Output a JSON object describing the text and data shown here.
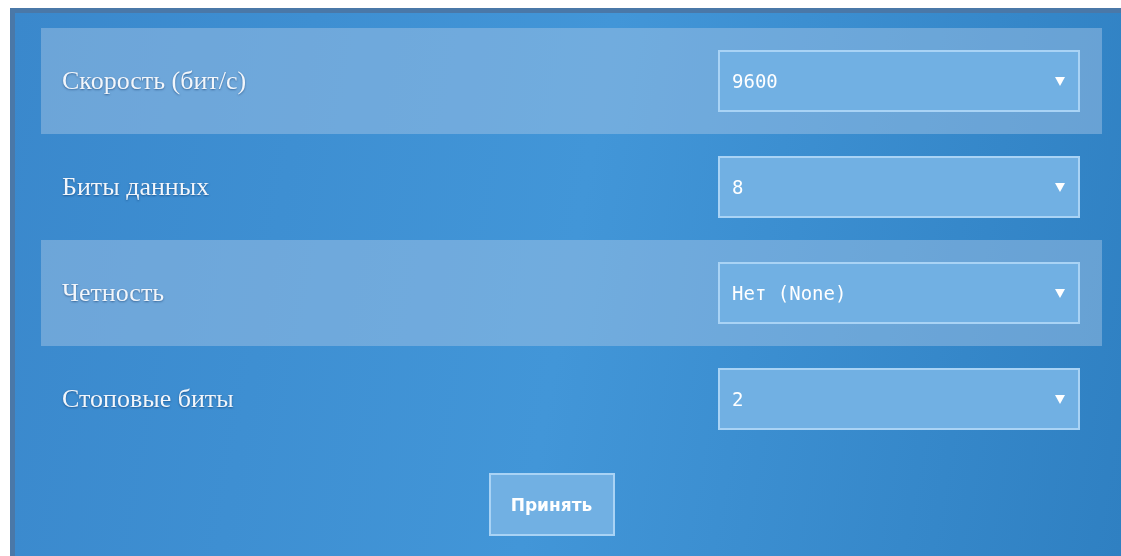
{
  "settings": [
    {
      "label": "Скорость (бит/с)",
      "value": "9600"
    },
    {
      "label": "Биты данных",
      "value": "8"
    },
    {
      "label": "Четность",
      "value": "Нет (None)"
    },
    {
      "label": "Стоповые биты",
      "value": "2"
    }
  ],
  "button": "Принять"
}
